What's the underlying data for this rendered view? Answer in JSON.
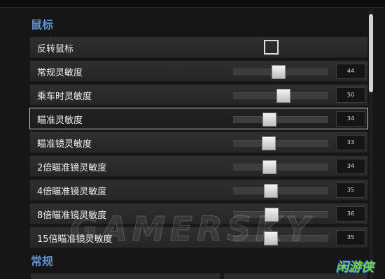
{
  "sections": {
    "mouse_title": "鼠标",
    "general_title": "常规"
  },
  "rows": [
    {
      "label": "反转鼠标",
      "type": "checkbox",
      "checked": false
    },
    {
      "label": "常规灵敏度",
      "type": "slider",
      "value": "44",
      "fraction": 0.44
    },
    {
      "label": "乘车时灵敏度",
      "type": "slider",
      "value": "50",
      "fraction": 0.5
    },
    {
      "label": "瞄准灵敏度",
      "type": "slider",
      "value": "34",
      "fraction": 0.34,
      "selected": true
    },
    {
      "label": "瞄准镜灵敏度",
      "type": "slider",
      "value": "33",
      "fraction": 0.33
    },
    {
      "label": "2倍瞄准镜灵敏度",
      "type": "slider",
      "value": "34",
      "fraction": 0.34
    },
    {
      "label": "4倍瞄准镜灵敏度",
      "type": "slider",
      "value": "35",
      "fraction": 0.35
    },
    {
      "label": "8倍瞄准镜灵敏度",
      "type": "slider",
      "value": "36",
      "fraction": 0.36
    },
    {
      "label": "15倍瞄准镜灵敏度",
      "type": "slider",
      "value": "35",
      "fraction": 0.35
    }
  ],
  "watermark": "GAMERSKY",
  "logo": "闲游侠"
}
